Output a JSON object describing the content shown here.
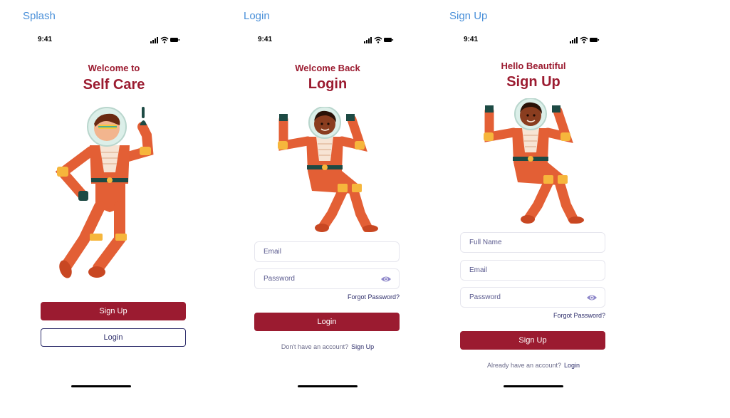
{
  "frames": {
    "splash": {
      "label": "Splash",
      "time": "9:41",
      "greeting": "Welcome to",
      "title": "Self Care",
      "signup_button": "Sign Up",
      "login_button": "Login"
    },
    "login": {
      "label": "Login",
      "time": "9:41",
      "greeting": "Welcome Back",
      "title": "Login",
      "email_placeholder": "Email",
      "password_placeholder": "Password",
      "forgot_password": "Forgot Password?",
      "login_button": "Login",
      "footer_prompt": "Don't have an account?",
      "footer_link": "Sign Up"
    },
    "signup": {
      "label": "Sign Up",
      "time": "9:41",
      "greeting": "Hello Beautiful",
      "title": "Sign Up",
      "fullname_placeholder": "Full Name",
      "email_placeholder": "Email",
      "password_placeholder": "Password",
      "forgot_password": "Forgot Password?",
      "signup_button": "Sign Up",
      "footer_prompt": "Already have an account?",
      "footer_link": "Login"
    }
  },
  "colors": {
    "brand": "#9b1b30",
    "frame_label": "#4a90d9",
    "text_dark": "#2e2e6b",
    "suit": "#e35f35",
    "suit_trim": "#f6b63c",
    "skin": "#8a3d1f"
  },
  "icons": {
    "status": [
      "signal-icon",
      "wifi-icon",
      "battery-icon"
    ],
    "password_toggle": "eye-icon"
  }
}
